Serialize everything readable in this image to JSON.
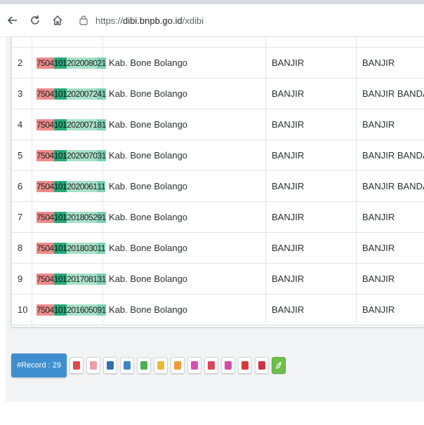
{
  "browser": {
    "url_scheme": "https://",
    "url_host": "dibi.bnpb.go.id",
    "url_path": "/xdibi"
  },
  "table": {
    "rows": [
      {
        "no": "2",
        "code": [
          "7504",
          "101",
          "2020080",
          "21"
        ],
        "kab": "Kab. Bone Bolango",
        "jenis": "BANJIR",
        "kejadian": "BANJIR"
      },
      {
        "no": "3",
        "code": [
          "7504",
          "101",
          "2020072",
          "41"
        ],
        "kab": "Kab. Bone Bolango",
        "jenis": "BANJIR",
        "kejadian": "BANJIR BANDANG"
      },
      {
        "no": "4",
        "code": [
          "7504",
          "101",
          "2020071",
          "81"
        ],
        "kab": "Kab. Bone Bolango",
        "jenis": "BANJIR",
        "kejadian": "BANJIR"
      },
      {
        "no": "5",
        "code": [
          "7504",
          "101",
          "2020070",
          "31"
        ],
        "kab": "Kab. Bone Bolango",
        "jenis": "BANJIR",
        "kejadian": "BANJIR BANDANG"
      },
      {
        "no": "6",
        "code": [
          "7504",
          "101",
          "2020061",
          "11"
        ],
        "kab": "Kab. Bone Bolango",
        "jenis": "BANJIR",
        "kejadian": "BANJIR BANDANG"
      },
      {
        "no": "7",
        "code": [
          "7504",
          "101",
          "2018052",
          "91"
        ],
        "kab": "Kab. Bone Bolango",
        "jenis": "BANJIR",
        "kejadian": "BANJIR"
      },
      {
        "no": "8",
        "code": [
          "7504",
          "101",
          "2018030",
          "11"
        ],
        "kab": "Kab. Bone Bolango",
        "jenis": "BANJIR",
        "kejadian": "BANJIR"
      },
      {
        "no": "9",
        "code": [
          "7504",
          "101",
          "2017081",
          "31"
        ],
        "kab": "Kab. Bone Bolango",
        "jenis": "BANJIR",
        "kejadian": "BANJIR"
      },
      {
        "no": "10",
        "code": [
          "7504",
          "101",
          "2016050",
          "91"
        ],
        "kab": "Kab. Bone Bolango",
        "jenis": "BANJIR",
        "kejadian": "BANJIR"
      }
    ]
  },
  "toolbar": {
    "record_label": "#Record : 29",
    "icons": [
      {
        "name": "red-flag-icon",
        "color": "#e04b4b"
      },
      {
        "name": "pink-drop-icon",
        "color": "#e7a0a8"
      },
      {
        "name": "blue-tornado-icon",
        "color": "#2f6fb2"
      },
      {
        "name": "blue-wave-icon",
        "color": "#3b86c6"
      },
      {
        "name": "green-check-icon",
        "color": "#4caf50"
      },
      {
        "name": "yellow-sun-icon",
        "color": "#e8b83a"
      },
      {
        "name": "orange-fire-icon",
        "color": "#f29a3b"
      },
      {
        "name": "magenta-volcano-icon",
        "color": "#d94fb0"
      },
      {
        "name": "red-building-icon",
        "color": "#d9455a"
      },
      {
        "name": "magenta-quake-icon",
        "color": "#d64ca2"
      },
      {
        "name": "red-landslide-icon",
        "color": "#d63b3b"
      },
      {
        "name": "red-warning-icon",
        "color": "#cc3344"
      },
      {
        "name": "green-leaf-icon",
        "color": "#6cc04a"
      }
    ]
  }
}
